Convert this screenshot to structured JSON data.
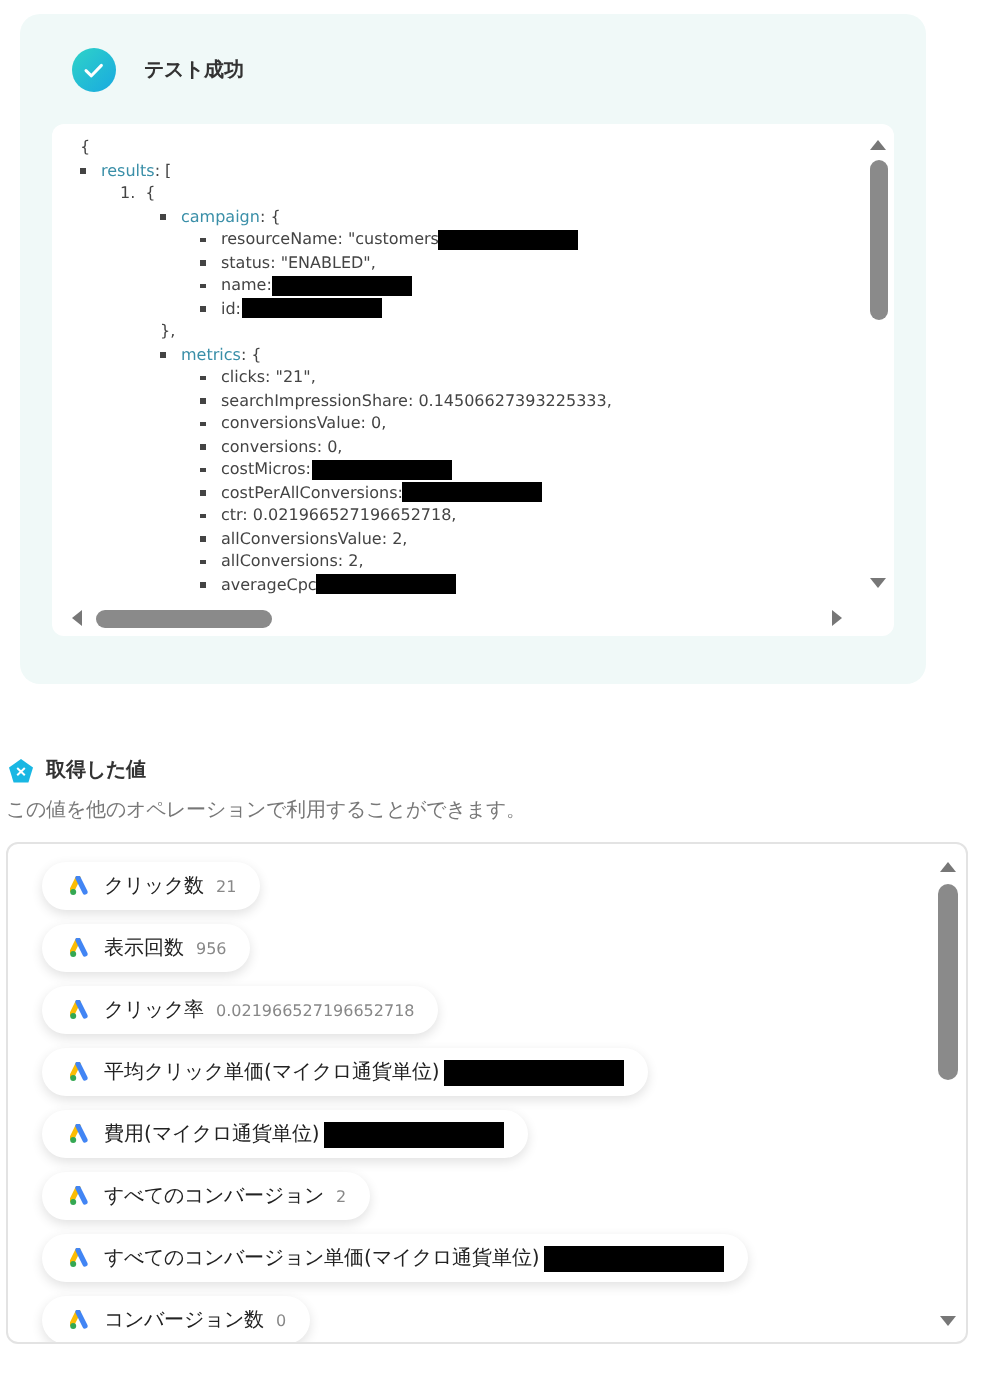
{
  "test_result": {
    "kind": "success",
    "title": "テスト成功"
  },
  "json_view": {
    "lines": [
      {
        "kind": "text",
        "text": "{"
      },
      {
        "kind": "entry",
        "key": "results",
        "text": ": [",
        "children": [
          {
            "kind": "numbered",
            "marker": "1.",
            "text": "{",
            "children": [
              {
                "kind": "entry",
                "key": "campaign",
                "text": ": {",
                "children": [
                  {
                    "kind": "entry",
                    "text": "resourceName: \"customers",
                    "redacted": true
                  },
                  {
                    "kind": "entry",
                    "text": "status: \"ENABLED\","
                  },
                  {
                    "kind": "entry",
                    "text": "name:",
                    "redacted": true
                  },
                  {
                    "kind": "entry",
                    "text": "id:",
                    "redacted": true
                  }
                ]
              },
              {
                "kind": "text",
                "text": "},"
              },
              {
                "kind": "entry",
                "key": "metrics",
                "text": ": {",
                "children": [
                  {
                    "kind": "entry",
                    "text": "clicks: \"21\","
                  },
                  {
                    "kind": "entry",
                    "text": "searchImpressionShare: 0.14506627393225333,"
                  },
                  {
                    "kind": "entry",
                    "text": "conversionsValue: 0,"
                  },
                  {
                    "kind": "entry",
                    "text": "conversions: 0,"
                  },
                  {
                    "kind": "entry",
                    "text": "costMicros:",
                    "redacted": true
                  },
                  {
                    "kind": "entry",
                    "text": "costPerAllConversions:",
                    "redacted": true
                  },
                  {
                    "kind": "entry",
                    "text": "ctr: 0.021966527196652718,"
                  },
                  {
                    "kind": "entry",
                    "text": "allConversionsValue: 2,"
                  },
                  {
                    "kind": "entry",
                    "text": "allConversions: 2,"
                  },
                  {
                    "kind": "entry",
                    "text": "averageCpc",
                    "redacted": true
                  }
                ]
              }
            ]
          }
        ]
      }
    ]
  },
  "values_section": {
    "title": "取得した値",
    "description": "この値を他のオペレーションで利用することができます。",
    "items": [
      {
        "label": "クリック数",
        "value": "21"
      },
      {
        "label": "表示回数",
        "value": "956"
      },
      {
        "label": "クリック率",
        "value": "0.021966527196652718"
      },
      {
        "label": "平均クリック単価(マイクロ通貨単位)",
        "redacted": true
      },
      {
        "label": "費用(マイクロ通貨単位)",
        "redacted": true
      },
      {
        "label": "すべてのコンバージョン",
        "value": "2"
      },
      {
        "label": "すべてのコンバージョン単価(マイクロ通貨単位)",
        "redacted": true
      },
      {
        "label": "コンバージョン数",
        "value": "0"
      }
    ]
  }
}
